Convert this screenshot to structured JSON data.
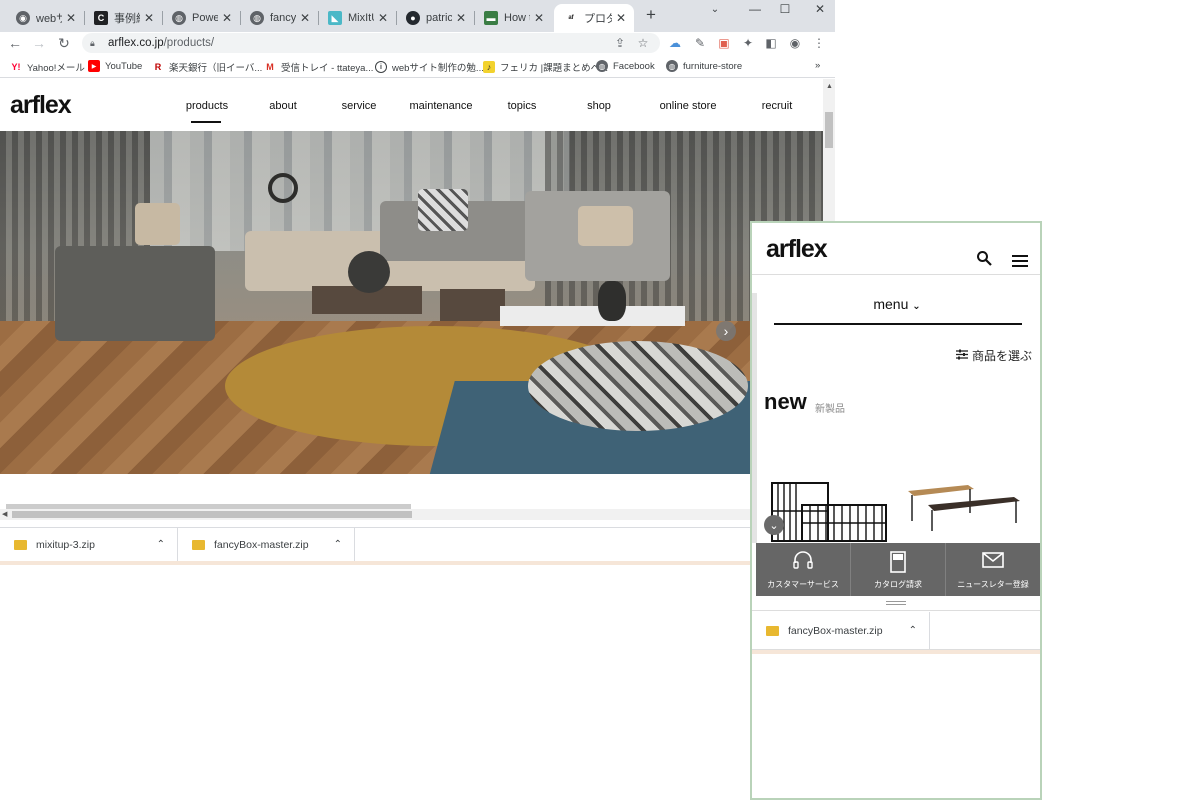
{
  "browser": {
    "tabs": [
      {
        "label": "webサイ",
        "favicon": "web-favicon"
      },
      {
        "label": "事例紹",
        "favicon": "c-favicon"
      },
      {
        "label": "PowerP",
        "favicon": "globe-favicon"
      },
      {
        "label": "fancyb",
        "favicon": "globe-favicon"
      },
      {
        "label": "MixItUp",
        "favicon": "mixitup-favicon"
      },
      {
        "label": "patrick",
        "favicon": "github-favicon"
      },
      {
        "label": "How to",
        "favicon": "generic-favicon"
      },
      {
        "label": "プロダク",
        "favicon": "arflex-favicon"
      }
    ],
    "active_tab": 7,
    "url_host": "arflex.co.jp",
    "url_path": "/products/",
    "bookmarks": [
      "Yahoo!メール",
      "YouTube",
      "楽天銀行（旧イーバ...",
      "受信トレイ - ttateya...",
      "webサイト制作の勉...",
      "フェリカ |課題まとめペ...",
      "Facebook",
      "furniture-store"
    ],
    "bookmarks_more": "»",
    "downloads": [
      "mixitup-3.zip",
      "fancyBox-master.zip"
    ]
  },
  "site": {
    "logo": "arflex",
    "nav": [
      "products",
      "about",
      "service",
      "maintenance",
      "topics",
      "shop",
      "online store",
      "recruit"
    ],
    "active_nav": "products"
  },
  "mobile": {
    "logo": "arflex",
    "menu_label": "menu",
    "filter_label": "商品を選ぶ",
    "new_heading": "new",
    "new_subheading": "新製品",
    "actions": [
      "カスタマーサービス",
      "カタログ請求",
      "ニュースレター登録"
    ],
    "download": "fancyBox-master.zip"
  },
  "colors": {
    "tabstrip": "#dee1e6",
    "download_icon": "#e8b830",
    "mobile_action_bar": "#666666",
    "mobile_border": "#b9d3b9"
  }
}
